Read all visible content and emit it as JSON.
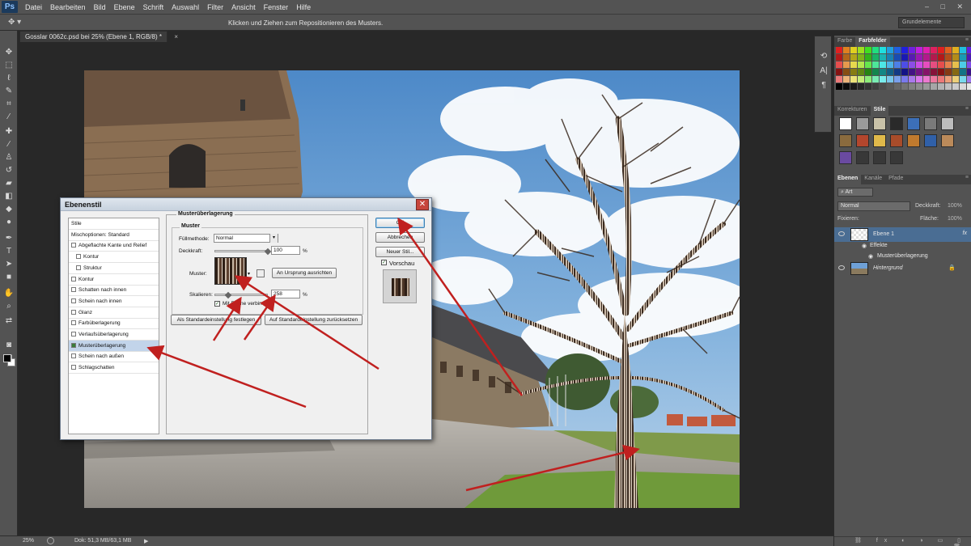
{
  "app": {
    "logo": "Ps",
    "menu": [
      "Datei",
      "Bearbeiten",
      "Bild",
      "Ebene",
      "Schrift",
      "Auswahl",
      "Filter",
      "Ansicht",
      "Fenster",
      "Hilfe"
    ],
    "window_controls": "– □ ✕"
  },
  "options_bar": {
    "tool_icon": "move-tool",
    "hint": "Klicken und Ziehen zum Repositionieren des Musters.",
    "workspace": "Grundelemente"
  },
  "document": {
    "tab_title": "Gosslar 0062c.psd bei 25% (Ebene 1, RGB/8) *",
    "tab_close": "×"
  },
  "status_bar": {
    "zoom": "25%",
    "doc_size": "Dok: 51,3 MB/63,1 MB",
    "arrow": "▶"
  },
  "panels": {
    "swatches": {
      "tabs": [
        "Farbe",
        "Farbfelder"
      ],
      "active": "Farbfelder"
    },
    "styles": {
      "tabs": [
        "Korrekturen",
        "Stile"
      ],
      "active": "Stile"
    },
    "layers": {
      "tabs": [
        "Ebenen",
        "Kanäle",
        "Pfade"
      ],
      "active": "Ebenen",
      "kind_filter": "Art",
      "blend_mode": "Normal",
      "opacity_label": "Deckkraft:",
      "opacity_value": "100%",
      "lock_label": "Fixieren:",
      "fill_label": "Fläche:",
      "fill_value": "100%",
      "items": [
        {
          "name": "Ebene 1",
          "selected": true,
          "fx": "fx"
        },
        {
          "name": "Effekte",
          "sub": true
        },
        {
          "name": "Musterüberlagerung",
          "sub": true
        },
        {
          "name": "Hintergrund",
          "locked": true
        }
      ],
      "footer_icons": "⛓ fx ◐ ◑ ▭ ▯ 🗑"
    }
  },
  "dialog": {
    "title": "Ebenenstil",
    "close": "✕",
    "styles_list": [
      {
        "label": "Stile",
        "checkbox": false
      },
      {
        "label": "Mischoptionen: Standard",
        "checkbox": false
      },
      {
        "label": "Abgeflachte Kante und Relief",
        "checkbox": true,
        "checked": false
      },
      {
        "label": "Kontur",
        "checkbox": true,
        "checked": false,
        "indent": true
      },
      {
        "label": "Struktur",
        "checkbox": true,
        "checked": false,
        "indent": true
      },
      {
        "label": "Kontur",
        "checkbox": true,
        "checked": false
      },
      {
        "label": "Schatten nach innen",
        "checkbox": true,
        "checked": false
      },
      {
        "label": "Schein nach innen",
        "checkbox": true,
        "checked": false
      },
      {
        "label": "Glanz",
        "checkbox": true,
        "checked": false
      },
      {
        "label": "Farbüberlagerung",
        "checkbox": true,
        "checked": false
      },
      {
        "label": "Verlaufsüberlagerung",
        "checkbox": true,
        "checked": false
      },
      {
        "label": "Musterüberlagerung",
        "checkbox": true,
        "checked": true,
        "selected": true
      },
      {
        "label": "Schein nach außen",
        "checkbox": true,
        "checked": false
      },
      {
        "label": "Schlagschatten",
        "checkbox": true,
        "checked": false
      }
    ],
    "group_title": "Musterüberlagerung",
    "subgroup_title": "Muster",
    "blend_label": "Füllmethode:",
    "blend_value": "Normal",
    "opacity_label": "Deckkraft:",
    "opacity_value": "100",
    "opacity_level": 1.0,
    "percent": "%",
    "pattern_label": "Muster:",
    "snap_origin": "An Ursprung ausrichten",
    "scale_label": "Skalieren:",
    "scale_value": "258",
    "scale_level": 0.26,
    "link_label": "Mit Ebene verbinden",
    "link_checked": true,
    "make_default": "Als Standardeinstellung festlegen",
    "reset_default": "Auf Standardeinstellung zurücksetzen",
    "ok": "OK",
    "cancel": "Abbrechen",
    "new_style": "Neuer Stil...",
    "preview_label": "Vorschau",
    "preview_checked": true
  },
  "colors": {
    "chrome": "#535353",
    "dark": "#282828",
    "annotation_arrow": "#c0201f",
    "selection": "#4a6d93"
  }
}
